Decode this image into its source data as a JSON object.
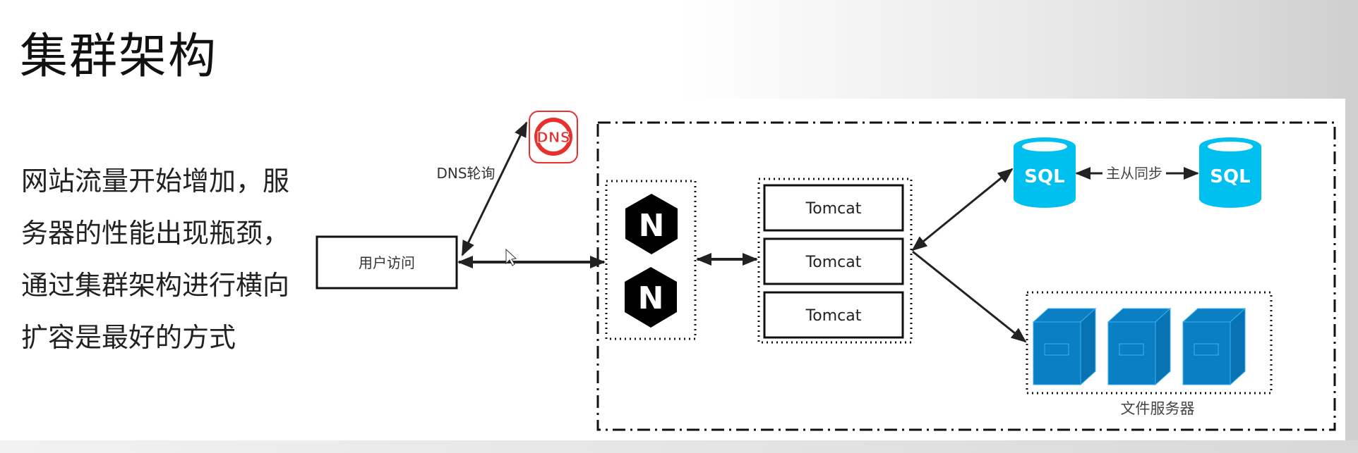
{
  "title": "集群架构",
  "description": "网站流量开始增加，服务器的性能出现瓶颈，通过集群架构进行横向扩容是最好的方式",
  "diagram": {
    "user_box": "用户访问",
    "dns_icon_label": "DNS",
    "dns_edge_label": "DNS轮询",
    "nginx_label": "N",
    "tomcat_nodes": [
      "Tomcat",
      "Tomcat",
      "Tomcat"
    ],
    "sql_label": "SQL",
    "sync_label": "主从同步",
    "file_servers_label": "文件服务器"
  },
  "colors": {
    "dns_red": "#e8312f",
    "sql_cyan": "#00c0f0",
    "server_blue": "#0a7fc4"
  }
}
